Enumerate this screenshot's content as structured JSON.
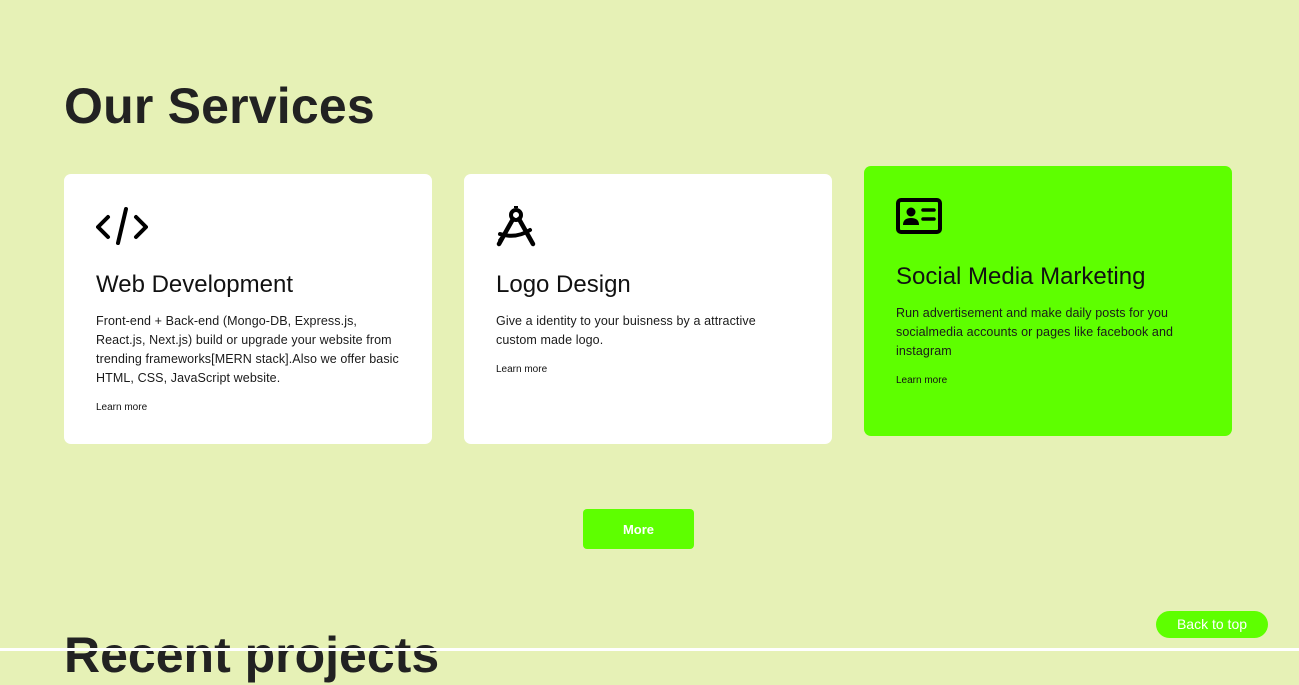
{
  "page": {
    "title": "Our Services",
    "next_section_title": "Recent projects"
  },
  "colors": {
    "background": "#e6f1b6",
    "accent": "#5eff00",
    "card": "#ffffff"
  },
  "services": [
    {
      "icon": "code-icon",
      "title": "Web Development",
      "text": "Front-end + Back-end (Mongo-DB, Express.js, React.js, Next.js) build or upgrade your website from trending frameworks[MERN stack].Also we offer basic HTML, CSS, JavaScript website.",
      "link": "Learn more"
    },
    {
      "icon": "compass-drafting-icon",
      "title": "Logo Design",
      "text": "Give a identity to your buisness by a attractive custom made logo.",
      "link": "Learn more"
    },
    {
      "icon": "id-card-icon",
      "title": "Social Media Marketing",
      "text": "Run advertisement and make daily posts for you socialmedia accounts or pages like facebook and instagram",
      "link": "Learn more"
    }
  ],
  "buttons": {
    "more": "More",
    "back_to_top": "Back to top"
  }
}
